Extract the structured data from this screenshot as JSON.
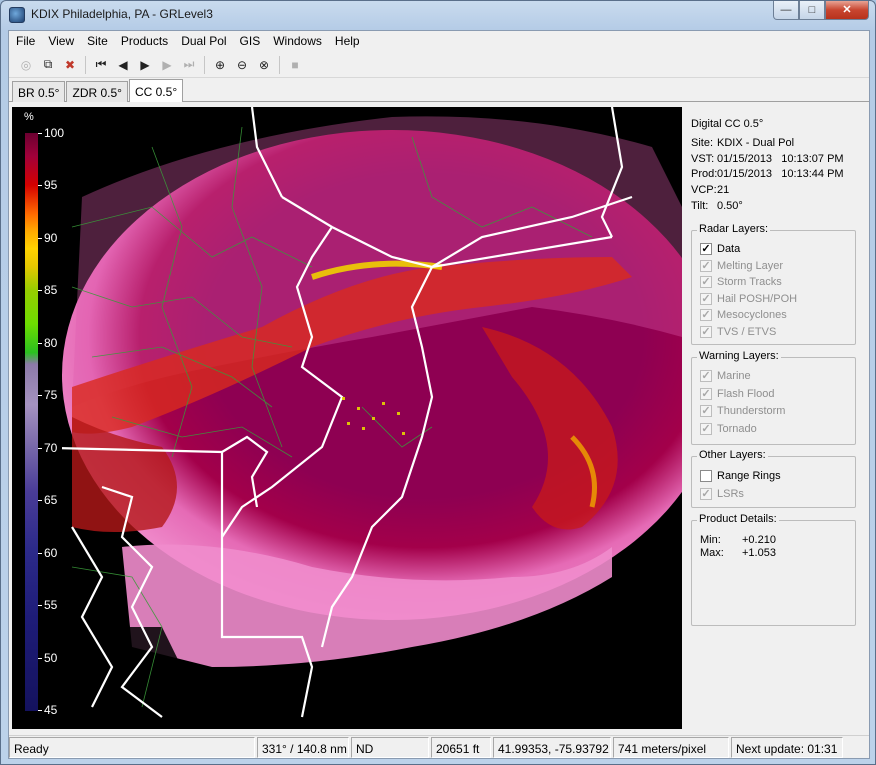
{
  "window": {
    "title": "KDIX Philadelphia, PA - GRLevel3",
    "minimize": "—",
    "maximize": "□",
    "close": "✕"
  },
  "menu": [
    "File",
    "View",
    "Site",
    "Products",
    "Dual Pol",
    "GIS",
    "Windows",
    "Help"
  ],
  "toolbar": {
    "buttons": [
      {
        "icon": "reload-icon",
        "glyph": "◎",
        "enabled": false
      },
      {
        "icon": "copy-icon",
        "glyph": "⧉",
        "enabled": true
      },
      {
        "icon": "delete-icon",
        "glyph": "✖",
        "enabled": true
      },
      {
        "icon": "first-frame-icon",
        "glyph": "⏮",
        "enabled": true
      },
      {
        "icon": "prev-frame-icon",
        "glyph": "◀",
        "enabled": true
      },
      {
        "icon": "play-icon",
        "glyph": "▶",
        "enabled": true
      },
      {
        "icon": "next-frame-icon",
        "glyph": "▶",
        "enabled": false
      },
      {
        "icon": "last-frame-icon",
        "glyph": "⏭",
        "enabled": false
      },
      {
        "icon": "zoom-in-icon",
        "glyph": "⊕",
        "enabled": true
      },
      {
        "icon": "zoom-out-icon",
        "glyph": "⊖",
        "enabled": true
      },
      {
        "icon": "zoom-reset-icon",
        "glyph": "⊗",
        "enabled": true
      },
      {
        "icon": "stop-icon",
        "glyph": "■",
        "enabled": false
      }
    ]
  },
  "tabs": [
    {
      "label": "BR 0.5°",
      "active": false
    },
    {
      "label": "ZDR 0.5°",
      "active": false
    },
    {
      "label": "CC 0.5°",
      "active": true
    }
  ],
  "legend": {
    "unit": "%",
    "labels": [
      "100",
      "95",
      "90",
      "85",
      "80",
      "75",
      "70",
      "65",
      "60",
      "55",
      "50",
      "45"
    ]
  },
  "product": {
    "name": "Digital CC 0.5°",
    "site_label": "Site:",
    "site": "KDIX - Dual Pol",
    "vst_label": "VST:",
    "vst": "01/15/2013   10:13:07 PM",
    "prod_label": "Prod:",
    "prod": "01/15/2013   10:13:44 PM",
    "vcp_label": "VCP:",
    "vcp": "21",
    "tilt_label": "Tilt:",
    "tilt": "0.50°"
  },
  "radar_layers": {
    "title": "Radar Layers:",
    "items": [
      {
        "label": "Data",
        "checked": true,
        "enabled": true
      },
      {
        "label": "Melting Layer",
        "checked": true,
        "enabled": false
      },
      {
        "label": "Storm Tracks",
        "checked": true,
        "enabled": false
      },
      {
        "label": "Hail POSH/POH",
        "checked": true,
        "enabled": false
      },
      {
        "label": "Mesocyclones",
        "checked": true,
        "enabled": false
      },
      {
        "label": "TVS / ETVS",
        "checked": true,
        "enabled": false
      }
    ]
  },
  "warning_layers": {
    "title": "Warning Layers:",
    "items": [
      {
        "label": "Marine",
        "checked": true,
        "enabled": false
      },
      {
        "label": "Flash Flood",
        "checked": true,
        "enabled": false
      },
      {
        "label": "Thunderstorm",
        "checked": true,
        "enabled": false
      },
      {
        "label": "Tornado",
        "checked": true,
        "enabled": false
      }
    ]
  },
  "other_layers": {
    "title": "Other Layers:",
    "items": [
      {
        "label": "Range Rings",
        "checked": false,
        "enabled": true
      },
      {
        "label": "LSRs",
        "checked": true,
        "enabled": false
      }
    ]
  },
  "product_details": {
    "title": "Product Details:",
    "min_label": "Min:",
    "min": "+0.210",
    "max_label": "Max:",
    "max": "+1.053"
  },
  "status": {
    "ready": "Ready",
    "azimuth_range": "331° / 140.8 nm",
    "value": "ND",
    "height": "20651 ft",
    "latlon": "41.99353, -75.93792",
    "resolution": "741 meters/pixel",
    "next_update": "Next update: 01:31"
  }
}
